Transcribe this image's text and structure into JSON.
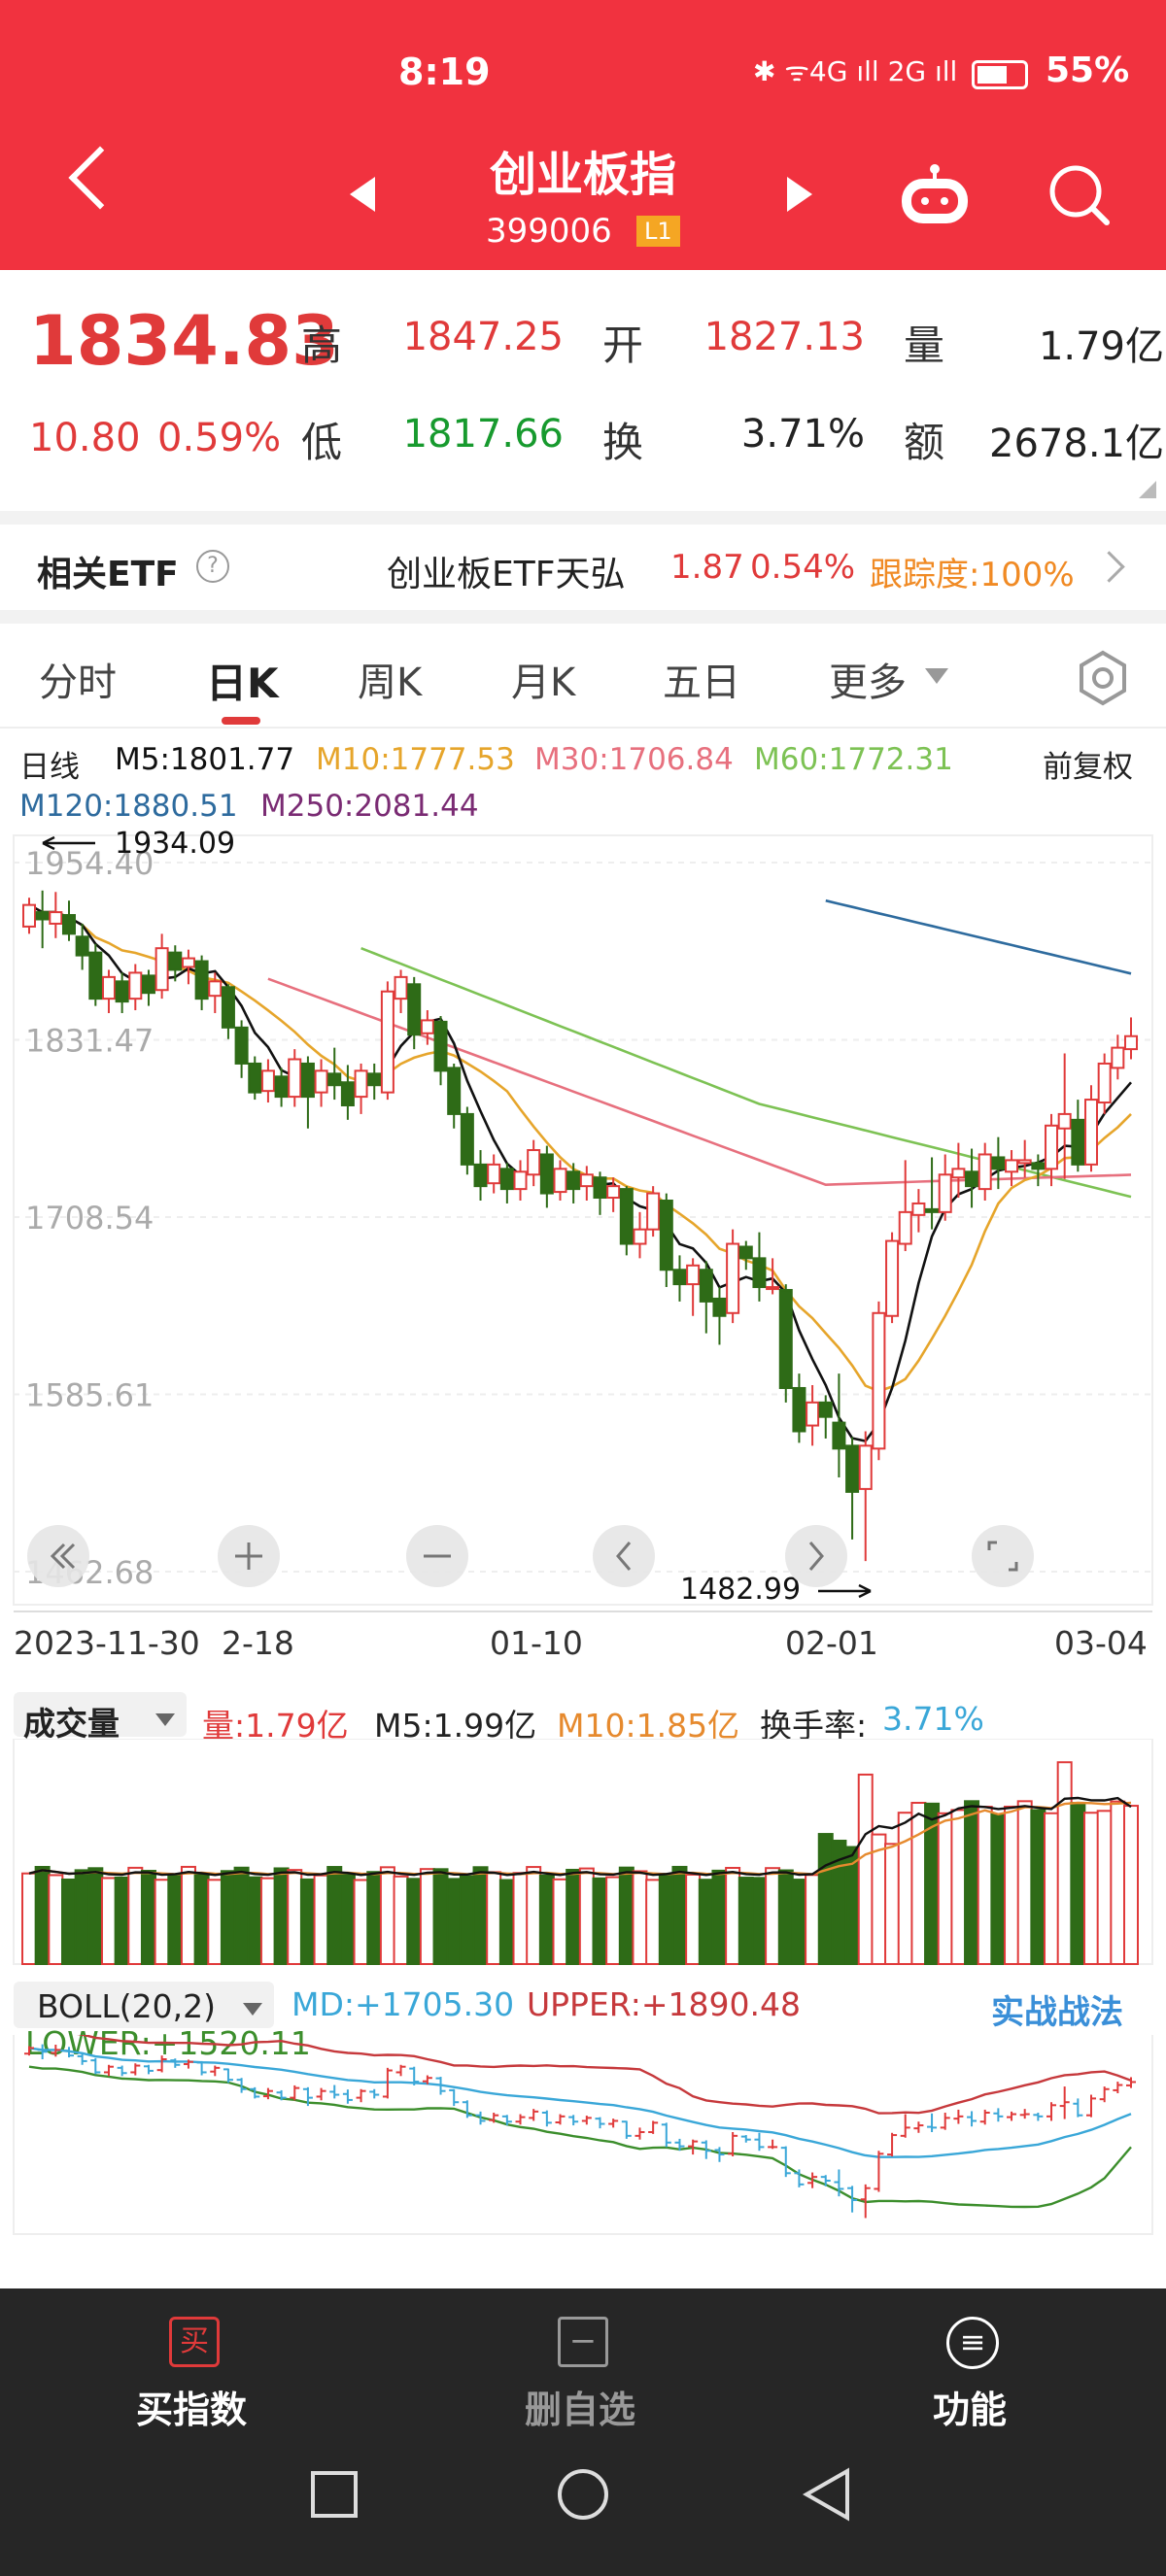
{
  "status_bar": {
    "time": "8:19",
    "icons": "✱ ᯤ4G ıll 2G ıll",
    "battery": "55%"
  },
  "header": {
    "title": "创业板指",
    "code": "399006",
    "level_badge": "L1"
  },
  "quote": {
    "price": "1834.83",
    "change": "10.80",
    "change_pct": "0.59%",
    "high_label": "高",
    "high": "1847.25",
    "open_label": "开",
    "open": "1827.13",
    "volume_label": "量",
    "volume": "1.79亿",
    "low_label": "低",
    "low": "1817.66",
    "turnover_label": "换",
    "turnover": "3.71%",
    "amount_label": "额",
    "amount": "2678.1亿"
  },
  "etf": {
    "title": "相关ETF",
    "help": "?",
    "name": "创业板ETF天弘",
    "price": "1.87",
    "pct": "0.54%",
    "tracking": "跟踪度:100%"
  },
  "tabs": [
    "分时",
    "日K",
    "周K",
    "月K",
    "五日",
    "更多"
  ],
  "ma_legend": {
    "label": "日线",
    "restore": "前复权",
    "m5": "M5:1801.77",
    "m10": "M10:1777.53",
    "m30": "M30:1706.84",
    "m60": "M60:1772.31",
    "m120": "M120:1880.51",
    "m250": "M250:2081.44"
  },
  "colors": {
    "up": "#e03a3a",
    "down": "#2e6b17",
    "m5": "#111111",
    "m10": "#e6a52b",
    "m30": "#e7707e",
    "m60": "#7dc254",
    "m120": "#2e6b9e",
    "m250": "#7a2b73",
    "boll_md": "#3aa7d8",
    "boll_upper": "#c6393c",
    "boll_lower": "#3c8e2c"
  },
  "price_axis": [
    "1954.40",
    "1831.47",
    "1708.54",
    "1585.61",
    "1462.68"
  ],
  "high_marker": "1934.09",
  "low_marker": "1482.99",
  "x_axis": [
    "2023-11-30",
    "2-18",
    "01-10",
    "02-01",
    "03-04"
  ],
  "volume": {
    "selector": "成交量",
    "vol": "量:1.79亿",
    "m5": "M5:1.99亿",
    "m10": "M10:1.85亿",
    "turnover_label": "换手率:",
    "turnover": "3.71%"
  },
  "boll": {
    "selector": "BOLL(20,2)",
    "md": "MD:+1705.30",
    "upper": "UPPER:+1890.48",
    "lower": "LOWER:+1520.11",
    "link": "实战战法"
  },
  "bottom_nav": [
    {
      "icon": "buy-icon",
      "glyph": "买",
      "label": "买指数"
    },
    {
      "icon": "remove-watchlist-icon",
      "glyph": "−",
      "label": "删自选"
    },
    {
      "icon": "menu-icon",
      "glyph": "≡",
      "label": "功能"
    }
  ],
  "chart_data": {
    "type": "candlestick",
    "ylim": [
      1462.68,
      1954.4
    ],
    "y_ticks": [
      1954.4,
      1831.47,
      1708.54,
      1585.61,
      1462.68
    ],
    "x_tick_labels": [
      "2023-11-30",
      "2-18",
      "01-10",
      "02-01",
      "03-04"
    ],
    "candles": [
      [
        1910,
        1925,
        1905,
        1930
      ],
      [
        1920,
        1915,
        1895,
        1935
      ],
      [
        1912,
        1920,
        1902,
        1934
      ],
      [
        1918,
        1905,
        1900,
        1928
      ],
      [
        1903,
        1890,
        1880,
        1912
      ],
      [
        1892,
        1860,
        1855,
        1898
      ],
      [
        1860,
        1875,
        1850,
        1880
      ],
      [
        1872,
        1858,
        1850,
        1878
      ],
      [
        1860,
        1878,
        1852,
        1884
      ],
      [
        1876,
        1864,
        1855,
        1880
      ],
      [
        1866,
        1895,
        1860,
        1905
      ],
      [
        1892,
        1880,
        1872,
        1897
      ],
      [
        1882,
        1888,
        1870,
        1894
      ],
      [
        1886,
        1860,
        1852,
        1890
      ],
      [
        1862,
        1872,
        1850,
        1878
      ],
      [
        1868,
        1840,
        1832,
        1870
      ],
      [
        1840,
        1815,
        1805,
        1845
      ],
      [
        1815,
        1795,
        1790,
        1820
      ],
      [
        1796,
        1810,
        1788,
        1818
      ],
      [
        1806,
        1792,
        1785,
        1812
      ],
      [
        1792,
        1818,
        1785,
        1825
      ],
      [
        1815,
        1792,
        1770,
        1820
      ],
      [
        1795,
        1810,
        1785,
        1818
      ],
      [
        1808,
        1800,
        1790,
        1826
      ],
      [
        1802,
        1786,
        1776,
        1814
      ],
      [
        1792,
        1810,
        1780,
        1815
      ],
      [
        1808,
        1800,
        1790,
        1815
      ],
      [
        1795,
        1865,
        1790,
        1872
      ],
      [
        1860,
        1875,
        1850,
        1880
      ],
      [
        1870,
        1835,
        1825,
        1875
      ],
      [
        1836,
        1845,
        1828,
        1852
      ],
      [
        1844,
        1810,
        1800,
        1848
      ],
      [
        1812,
        1780,
        1770,
        1815
      ],
      [
        1780,
        1745,
        1738,
        1785
      ],
      [
        1745,
        1730,
        1720,
        1755
      ],
      [
        1732,
        1745,
        1725,
        1752
      ],
      [
        1742,
        1728,
        1718,
        1746
      ],
      [
        1728,
        1740,
        1720,
        1748
      ],
      [
        1738,
        1755,
        1730,
        1762
      ],
      [
        1752,
        1725,
        1715,
        1758
      ],
      [
        1726,
        1742,
        1720,
        1748
      ],
      [
        1740,
        1728,
        1718,
        1746
      ],
      [
        1730,
        1738,
        1720,
        1744
      ],
      [
        1736,
        1722,
        1710,
        1740
      ],
      [
        1722,
        1730,
        1712,
        1736
      ],
      [
        1728,
        1690,
        1682,
        1730
      ],
      [
        1690,
        1700,
        1680,
        1712
      ],
      [
        1700,
        1725,
        1695,
        1730
      ],
      [
        1720,
        1672,
        1660,
        1725
      ],
      [
        1672,
        1662,
        1650,
        1682
      ],
      [
        1662,
        1675,
        1640,
        1680
      ],
      [
        1672,
        1650,
        1628,
        1678
      ],
      [
        1652,
        1640,
        1620,
        1660
      ],
      [
        1642,
        1690,
        1635,
        1700
      ],
      [
        1688,
        1680,
        1672,
        1692
      ],
      [
        1680,
        1660,
        1650,
        1698
      ],
      [
        1660,
        1660,
        1655,
        1680
      ],
      [
        1658,
        1590,
        1580,
        1662
      ],
      [
        1590,
        1560,
        1552,
        1600
      ],
      [
        1564,
        1580,
        1550,
        1592
      ],
      [
        1580,
        1570,
        1555,
        1585
      ],
      [
        1566,
        1548,
        1528,
        1600
      ],
      [
        1550,
        1518,
        1485,
        1556
      ],
      [
        1520,
        1550,
        1470,
        1560
      ],
      [
        1548,
        1642,
        1540,
        1650
      ],
      [
        1640,
        1692,
        1635,
        1698
      ],
      [
        1690,
        1712,
        1685,
        1748
      ],
      [
        1710,
        1718,
        1698,
        1728
      ],
      [
        1714,
        1712,
        1700,
        1750
      ],
      [
        1712,
        1738,
        1706,
        1752
      ],
      [
        1736,
        1742,
        1722,
        1760
      ],
      [
        1740,
        1730,
        1715,
        1756
      ],
      [
        1728,
        1752,
        1720,
        1760
      ],
      [
        1750,
        1742,
        1728,
        1764
      ],
      [
        1740,
        1748,
        1730,
        1755
      ],
      [
        1746,
        1748,
        1736,
        1762
      ],
      [
        1746,
        1742,
        1730,
        1752
      ],
      [
        1742,
        1772,
        1730,
        1780
      ],
      [
        1770,
        1780,
        1735,
        1822
      ],
      [
        1776,
        1745,
        1740,
        1790
      ],
      [
        1745,
        1790,
        1740,
        1800
      ],
      [
        1788,
        1815,
        1780,
        1822
      ],
      [
        1812,
        1826,
        1804,
        1835
      ],
      [
        1825,
        1834,
        1818,
        1847
      ]
    ]
  }
}
